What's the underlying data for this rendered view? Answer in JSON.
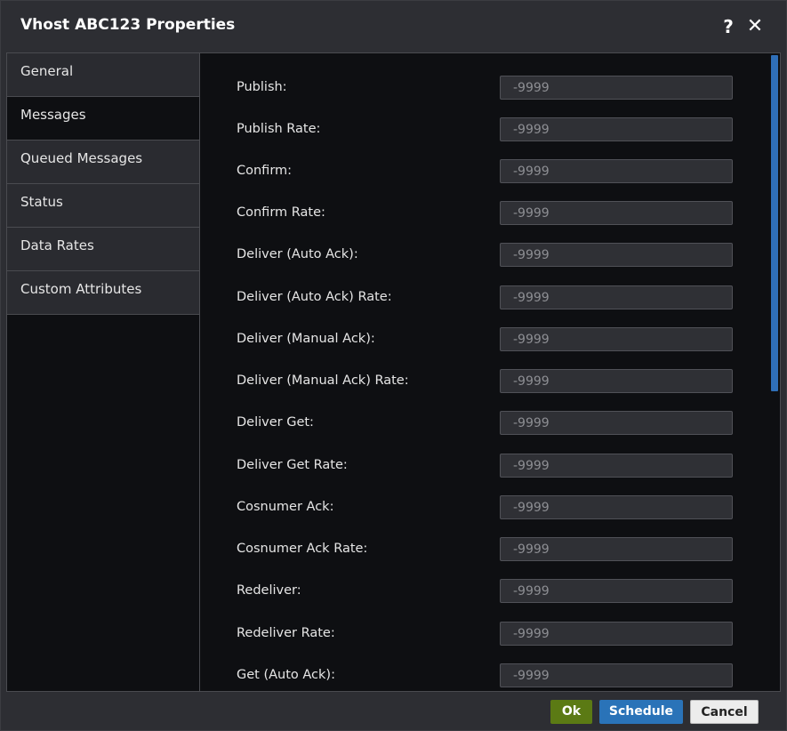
{
  "dialog": {
    "title": "Vhost ABC123 Properties",
    "help_label": "?",
    "close_label": "✕"
  },
  "sidebar": {
    "items": [
      {
        "label": "General",
        "active": false
      },
      {
        "label": "Messages",
        "active": true
      },
      {
        "label": "Queued Messages",
        "active": false
      },
      {
        "label": "Status",
        "active": false
      },
      {
        "label": "Data Rates",
        "active": false
      },
      {
        "label": "Custom Attributes",
        "active": false
      }
    ]
  },
  "form": {
    "fields": [
      {
        "label": "Publish:",
        "placeholder": "-9999"
      },
      {
        "label": "Publish Rate:",
        "placeholder": "-9999"
      },
      {
        "label": "Confirm:",
        "placeholder": "-9999"
      },
      {
        "label": "Confirm Rate:",
        "placeholder": "-9999"
      },
      {
        "label": "Deliver (Auto Ack):",
        "placeholder": "-9999"
      },
      {
        "label": "Deliver (Auto Ack) Rate:",
        "placeholder": "-9999"
      },
      {
        "label": "Deliver (Manual Ack):",
        "placeholder": "-9999"
      },
      {
        "label": "Deliver (Manual Ack) Rate:",
        "placeholder": "-9999"
      },
      {
        "label": "Deliver Get:",
        "placeholder": "-9999"
      },
      {
        "label": "Deliver Get Rate:",
        "placeholder": "-9999"
      },
      {
        "label": "Cosnumer Ack:",
        "placeholder": "-9999"
      },
      {
        "label": "Cosnumer Ack Rate:",
        "placeholder": "-9999"
      },
      {
        "label": "Redeliver:",
        "placeholder": "-9999"
      },
      {
        "label": "Redeliver Rate:",
        "placeholder": "-9999"
      },
      {
        "label": "Get (Auto Ack):",
        "placeholder": "-9999"
      }
    ]
  },
  "footer": {
    "ok_label": "Ok",
    "schedule_label": "Schedule",
    "cancel_label": "Cancel"
  },
  "colors": {
    "ok": "#5b7a14",
    "schedule": "#2a73b8",
    "scrollbar_thumb": "#2f6fb8"
  }
}
